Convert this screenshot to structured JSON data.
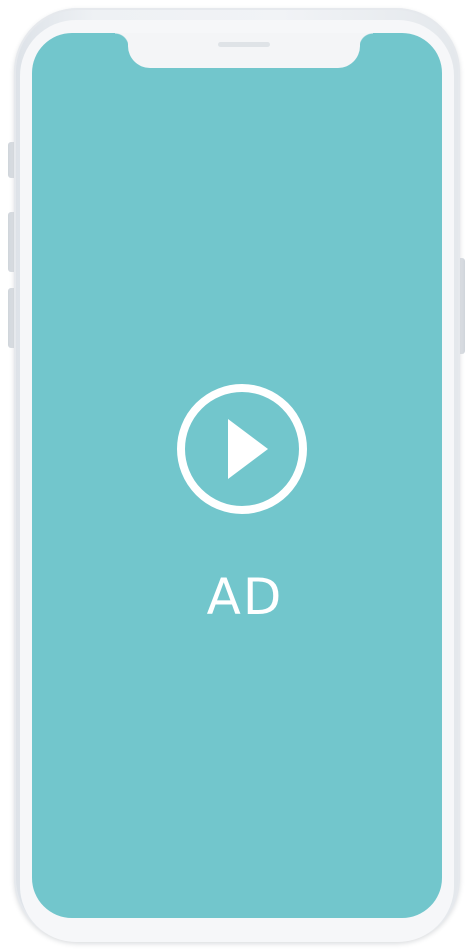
{
  "ad": {
    "label": "AD",
    "icon": "play-circle-icon"
  },
  "colors": {
    "screen_background": "#72c6cc",
    "phone_frame": "#eef1f4",
    "foreground": "#ffffff"
  }
}
